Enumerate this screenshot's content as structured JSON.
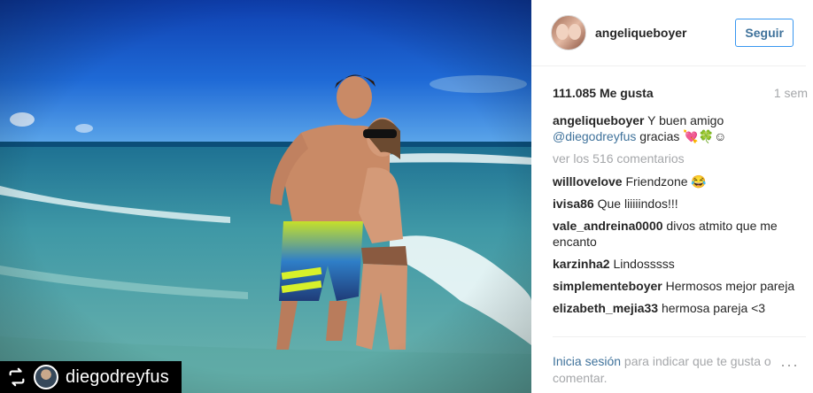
{
  "regram": {
    "username": "diegodreyfus"
  },
  "post": {
    "author": "angeliqueboyer",
    "follow_label": "Seguir",
    "likes": "111.085 Me gusta",
    "time": "1 sem",
    "caption_user": "angeliqueboyer",
    "caption_text": " Y buen amigo",
    "caption_mention": "@diegodreyfus",
    "caption_rest": " gracias 💘🍀☺",
    "view_all": "ver los 516 comentarios",
    "comments": [
      {
        "user": "willlovelove",
        "text": " Friendzone 😂"
      },
      {
        "user": "ivisa86",
        "text": " Que liiiiindos!!!"
      },
      {
        "user": "vale_andreina0000",
        "text": " divos atmito que me encanto"
      },
      {
        "user": "karzinha2",
        "text": " Lindosssss"
      },
      {
        "user": "simplementeboyer",
        "text": " Hermosos mejor pareja"
      },
      {
        "user": "elizabeth_mejia33",
        "text": " hermosa pareja <3"
      }
    ],
    "footer_login": "Inicia sesión",
    "footer_text": " para indicar que te gusta o comentar.",
    "more": "···"
  },
  "colors": {
    "link": "#3f729b",
    "muted": "#a5a7aa",
    "follow_border": "#3897f0"
  },
  "icons": {
    "repost": "repost-icon",
    "more": "more-options-icon"
  }
}
